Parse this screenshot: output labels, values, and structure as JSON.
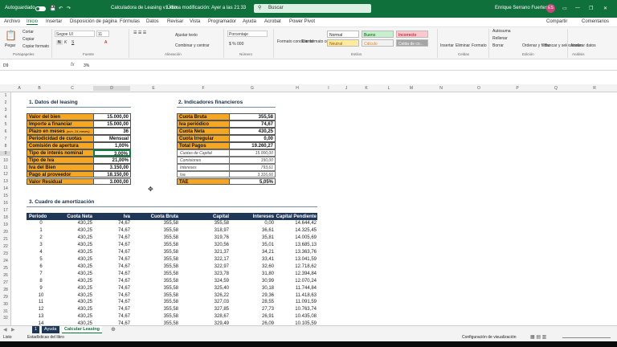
{
  "titlebar": {
    "autosave": "Autoguardado",
    "file": "Calculadora de Leasing v1.xlsx",
    "modified": "Última modificación: Ayer a las 21:33",
    "search_placeholder": "Buscar",
    "user": "Enrique Serrano Fuertes",
    "initials": "ES"
  },
  "menu": [
    "Archivo",
    "Inicio",
    "Insertar",
    "Disposición de página",
    "Fórmulas",
    "Datos",
    "Revisar",
    "Vista",
    "Programador",
    "Ayuda",
    "Acrobat",
    "Power Pivot"
  ],
  "menu_active": "Inicio",
  "share": "Compartir",
  "comments": "Comentarios",
  "ribbon": {
    "paste": "Pegar",
    "cut": "Cortar",
    "copy": "Copiar",
    "copy_format": "Copiar formato",
    "clipboard": "Portapapeles",
    "font_name": "Segoe UI",
    "font_size": "11",
    "font_group": "Fuente",
    "wrap": "Ajustar texto",
    "merge": "Combinar y centrar",
    "alignment_group": "Alineación",
    "number_format": "Porcentaje",
    "number_group": "Número",
    "conditional": "Formato condicional",
    "as_table": "Dar formato como tabla",
    "style_normal": "Normal",
    "style_bueno": "Bueno",
    "style_incorrecto": "Incorrecto",
    "style_neutral": "Neutral",
    "style_calculo": "Cálculo",
    "style_celda": "Celda de co...",
    "styles_group": "Estilos",
    "insert": "Insertar",
    "delete": "Eliminar",
    "format": "Formato",
    "cells_group": "Celdas",
    "autosum": "Autosuma",
    "fill": "Rellenar",
    "clear": "Borrar",
    "sort": "Ordenar y filtrar",
    "find": "Buscar y seleccionar",
    "edit_group": "Edición",
    "analyze": "Analizar datos",
    "analysis_group": "Análisis"
  },
  "formula_bar": {
    "cell_ref": "D9",
    "fx": "fx",
    "value": "3%"
  },
  "columns": [
    "A",
    "B",
    "C",
    "D",
    "E",
    "F",
    "G",
    "H",
    "I",
    "J",
    "K",
    "L",
    "M",
    "N",
    "O",
    "P",
    "Q",
    "R"
  ],
  "section1": {
    "title": "1. Datos del leasing",
    "rows": [
      {
        "label": "Valor del bien",
        "value": "15.000,00"
      },
      {
        "label": "Importe a financiar",
        "value": "15.000,00"
      },
      {
        "label": "Plazo en meses",
        "note": "(mín. 24 meses)",
        "value": "36"
      },
      {
        "label": "Periodicidad de cuotas",
        "value": "Mensual"
      },
      {
        "label": "Comisión de apertura",
        "value": "1,00%"
      },
      {
        "label": "Tipo de interés nominal",
        "value": "3,00%"
      },
      {
        "label": "Tipo de Iva",
        "value": "21,00%"
      },
      {
        "label": "Iva del Bien",
        "value": "3.150,00"
      },
      {
        "label": "Pago al proveedor",
        "value": "18.150,00"
      },
      {
        "label": "Valor Residual",
        "value": "3.000,00"
      }
    ]
  },
  "section2": {
    "title": "2. Indicadores financieros",
    "rows": [
      {
        "label": "Cuota Bruta",
        "value": "355,58",
        "style": "main"
      },
      {
        "label": "Iva periódico",
        "value": "74,67",
        "style": "main"
      },
      {
        "label": "Cuota Neta",
        "value": "430,25",
        "style": "main"
      },
      {
        "label": "Cuota Irregular",
        "value": "0,00",
        "style": "main"
      },
      {
        "label": "Total Pagos",
        "value": "19.260,27",
        "style": "main"
      },
      {
        "label": "Cuotas de Capital",
        "value": "15.000,00",
        "style": "sub"
      },
      {
        "label": "Comisiones",
        "value": "150,00",
        "style": "sub"
      },
      {
        "label": "Intereses",
        "value": "793,61",
        "style": "sub"
      },
      {
        "label": "Iva",
        "value": "3.316,66",
        "style": "sub"
      },
      {
        "label": "TAE",
        "value": "5,05%",
        "style": "main"
      }
    ]
  },
  "section3": {
    "title": "3. Cuadro de amortización",
    "headers": [
      "Periodo",
      "Cuota Neta",
      "Iva",
      "Cuota Bruta",
      "Capital",
      "Intereses",
      "Capital Pendiente"
    ],
    "rows": [
      [
        "0",
        "430,25",
        "74,67",
        "355,58",
        "355,58",
        "0,00",
        "14.644,42"
      ],
      [
        "1",
        "430,25",
        "74,67",
        "355,58",
        "318,97",
        "36,61",
        "14.325,45"
      ],
      [
        "2",
        "430,25",
        "74,67",
        "355,58",
        "319,76",
        "35,81",
        "14.005,69"
      ],
      [
        "3",
        "430,25",
        "74,67",
        "355,58",
        "320,56",
        "35,01",
        "13.685,13"
      ],
      [
        "4",
        "430,25",
        "74,67",
        "355,58",
        "321,37",
        "34,21",
        "13.363,76"
      ],
      [
        "5",
        "430,25",
        "74,67",
        "355,58",
        "322,17",
        "33,41",
        "13.041,59"
      ],
      [
        "6",
        "430,25",
        "74,67",
        "355,58",
        "322,97",
        "32,60",
        "12.718,62"
      ],
      [
        "7",
        "430,25",
        "74,67",
        "355,58",
        "323,78",
        "31,80",
        "12.394,84"
      ],
      [
        "8",
        "430,25",
        "74,67",
        "355,58",
        "324,59",
        "30,99",
        "12.070,24"
      ],
      [
        "9",
        "430,25",
        "74,67",
        "355,58",
        "325,40",
        "30,18",
        "11.744,84"
      ],
      [
        "10",
        "430,25",
        "74,67",
        "355,58",
        "326,22",
        "29,36",
        "11.418,63"
      ],
      [
        "11",
        "430,25",
        "74,67",
        "355,58",
        "327,03",
        "28,55",
        "11.091,59"
      ],
      [
        "12",
        "430,25",
        "74,67",
        "355,58",
        "327,85",
        "27,73",
        "10.763,74"
      ],
      [
        "13",
        "430,25",
        "74,67",
        "355,58",
        "328,67",
        "26,91",
        "10.435,08"
      ],
      [
        "14",
        "430,25",
        "74,67",
        "355,58",
        "329,49",
        "26,09",
        "10.105,59"
      ]
    ]
  },
  "sheets": [
    "1",
    "Ayuda",
    "Calcular Leasing"
  ],
  "active_sheet": "Calcular Leasing",
  "status": {
    "ready": "Listo",
    "stats": "Estadísticas del libro",
    "display": "Configuración de visualización"
  }
}
